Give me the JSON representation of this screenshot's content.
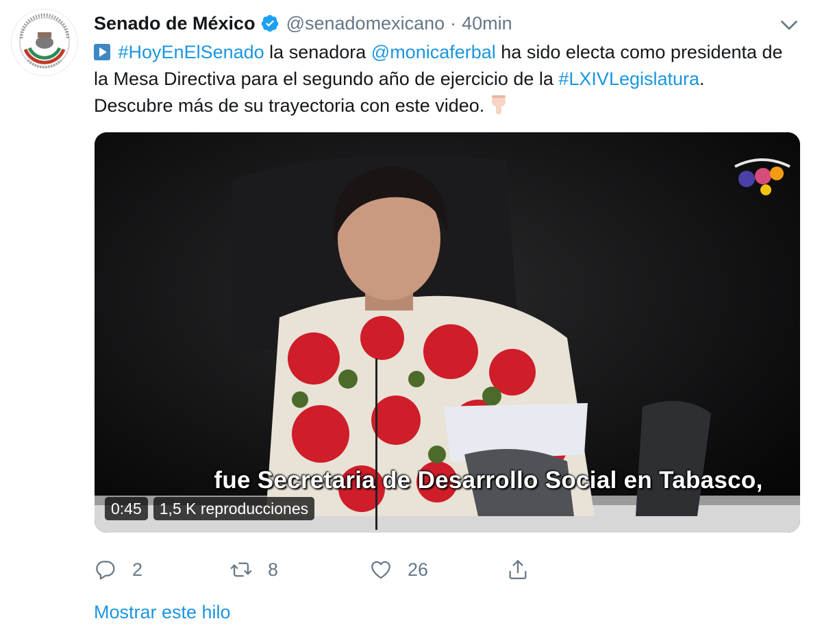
{
  "tweet": {
    "author_name": "Senado de México",
    "handle": "@senadomexicano",
    "separator": "·",
    "time": "40min",
    "verified": true,
    "avatar_icon": "senado-seal-logo-icon",
    "text": {
      "part1": " ",
      "hashtag1": "#HoyEnElSenado",
      "part2": " la senadora ",
      "mention": "@monicaferbal",
      "part3": " ha sido electa como presidenta de la Mesa Directiva para el segundo año de ejercicio de la ",
      "hashtag2": "#LXIVLegislatura",
      "part4": ". Descubre más de su trayectoria con este video."
    },
    "emoji_icons": [
      "play-button-emoji",
      "backhand-index-pointing-down-emoji"
    ]
  },
  "video": {
    "subtitle": "fue Secretaria de Desarrollo Social en Tabasco,",
    "duration": "0:45",
    "views": "1,5 K reproducciones",
    "channel_logo_icon": "channel-logo-icon"
  },
  "actions": {
    "reply_count": "2",
    "retweet_count": "8",
    "like_count": "26"
  },
  "thread_link": "Mostrar este hilo",
  "colors": {
    "link": "#1b95e0",
    "secondary_text": "#657786",
    "primary_text": "#14171a",
    "verified_badge": "#1da1f2"
  }
}
